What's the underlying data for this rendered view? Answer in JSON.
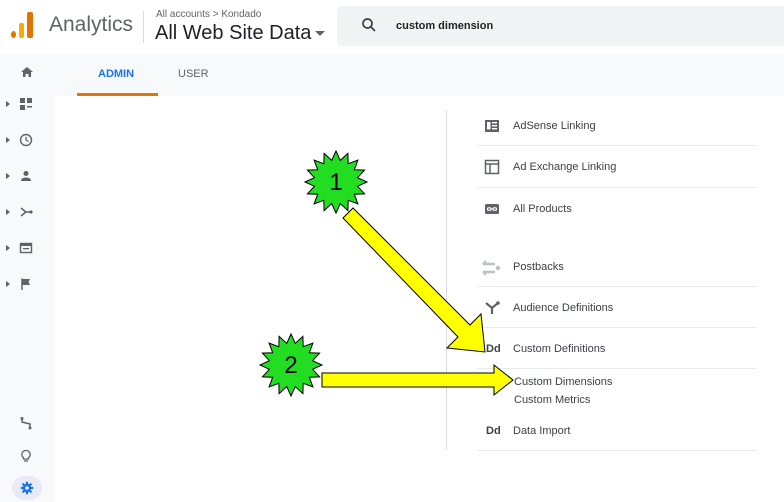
{
  "header": {
    "app_name": "Analytics",
    "breadcrumb": "All accounts > Kondado",
    "property_name": "All Web Site Data",
    "search_value": "custom dimension"
  },
  "tabs": [
    {
      "label": "ADMIN",
      "active": true
    },
    {
      "label": "USER",
      "active": false
    }
  ],
  "left_rail": {
    "items": [
      "home-icon",
      "customization-icon",
      "realtime-icon",
      "audience-icon",
      "acquisition-icon",
      "behavior-icon",
      "conversions-icon"
    ],
    "bottom": [
      "attribution-icon",
      "discover-icon",
      "admin-gear-icon"
    ]
  },
  "property_column": {
    "items": [
      {
        "label": "AdSense Linking",
        "icon": "adsense-icon"
      },
      {
        "label": "Ad Exchange Linking",
        "icon": "ad-exchange-icon"
      },
      {
        "label": "All Products",
        "icon": "all-products-icon"
      },
      {
        "label": "Postbacks",
        "icon": "postbacks-icon"
      },
      {
        "label": "Audience Definitions",
        "icon": "audience-definitions-icon"
      },
      {
        "label": "Custom Definitions",
        "icon_text": "Dd"
      },
      {
        "label": "Data Import",
        "icon_text": "Dd"
      }
    ],
    "custom_definitions_sub": [
      "Custom Dimensions",
      "Custom Metrics"
    ]
  },
  "annotations": {
    "badge_1": "1",
    "badge_2": "2",
    "badge_color": "#22dd22",
    "arrow_color": "#ffff00"
  },
  "colors": {
    "accent_orange": "#e37400",
    "tab_active_blue": "#1a73e8",
    "gear_highlight": "#e8eaf6"
  }
}
